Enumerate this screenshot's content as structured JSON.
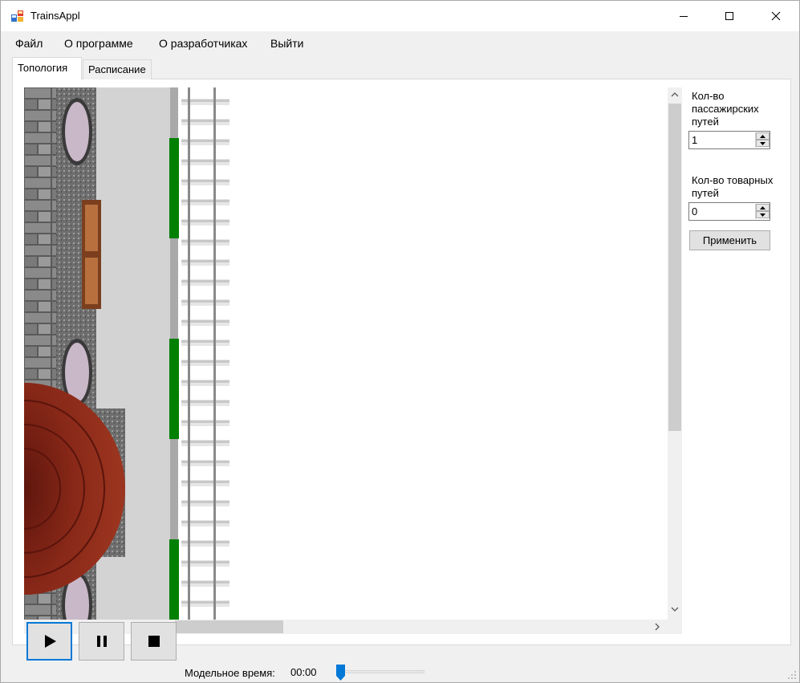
{
  "window": {
    "title": "TrainsAppl"
  },
  "menu": {
    "items": [
      "Файл",
      "О программе",
      "О разработчиках",
      "Выйти"
    ]
  },
  "tabs": [
    "Топология",
    "Расписание"
  ],
  "active_tab": "Топология",
  "settings": {
    "passenger_label": "Кол-во пассажирских путей",
    "passenger_value": "1",
    "freight_label": "Кол-во товарных путей",
    "freight_value": "0",
    "apply_label": "Применить"
  },
  "controls": {
    "play_icon": "play-icon",
    "pause_icon": "pause-icon",
    "stop_icon": "stop-icon"
  },
  "model_time": {
    "label": "Модельное время:",
    "value": "00:00",
    "slider_level": 0.05
  },
  "colors": {
    "accent": "#0078d7",
    "signal_green": "#008000",
    "platform_gray": "#d3d3d3",
    "roof_red": "#8b2a1a"
  }
}
